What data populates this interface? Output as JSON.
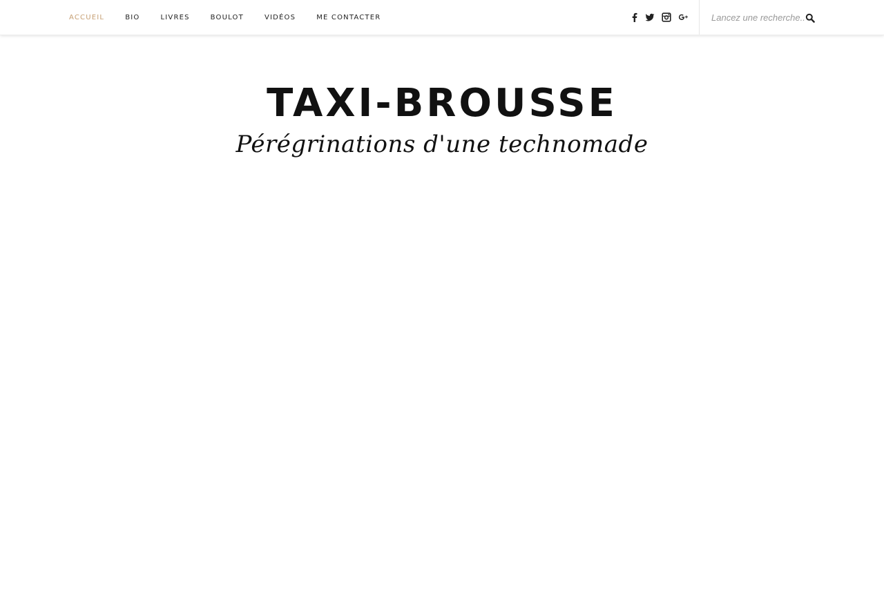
{
  "nav": {
    "items": [
      {
        "label": "ACCUEIL",
        "active": true
      },
      {
        "label": "BIO",
        "active": false
      },
      {
        "label": "LIVRES",
        "active": false
      },
      {
        "label": "BOULOT",
        "active": false
      },
      {
        "label": "VIDÉOS",
        "active": false
      },
      {
        "label": "ME CONTACTER",
        "active": false
      }
    ],
    "active_color": "#c69f73"
  },
  "social": {
    "icons": [
      "facebook-icon",
      "twitter-icon",
      "instagram-icon",
      "google-plus-icon"
    ]
  },
  "search": {
    "placeholder": "Lancez une recherche...",
    "icon": "search-icon"
  },
  "header": {
    "title": "TAXI-BROUSSE",
    "tagline": "Pérégrinations d'une technomade"
  }
}
